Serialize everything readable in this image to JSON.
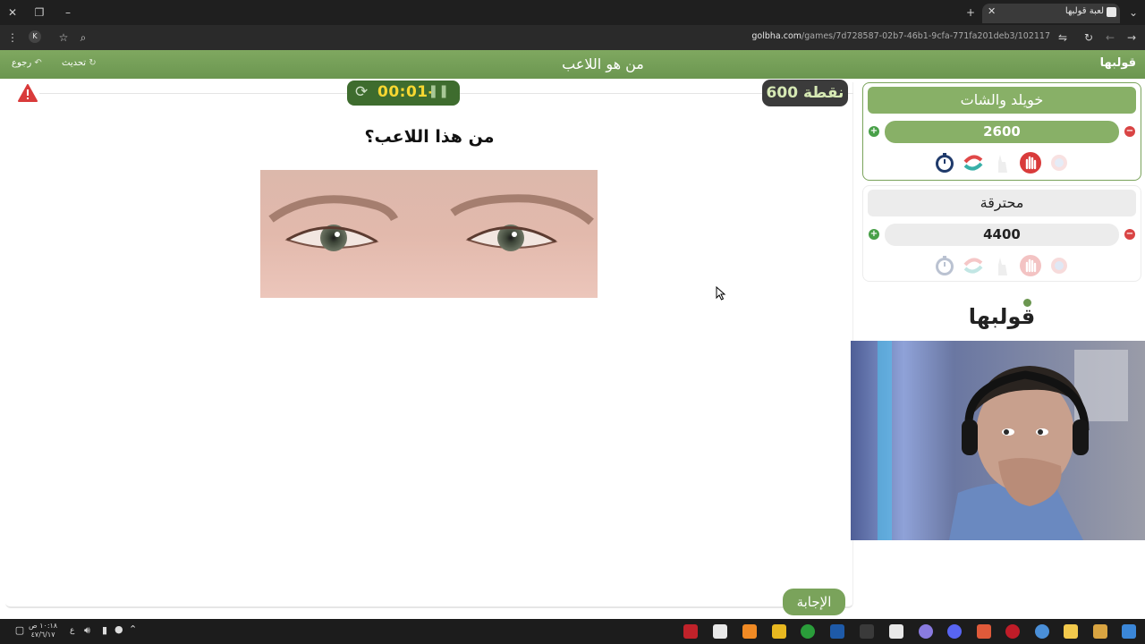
{
  "browser": {
    "tab_title": "لعبة قولبها",
    "url_domain": "golbha.com",
    "url_path": "/games/7d728587-02b7-46b1-9cfa-771fa201deb3/102117",
    "profile_initial": "K"
  },
  "header": {
    "title": "من هو اللاعب",
    "logo": "قولبها",
    "refresh_label": "تحديث",
    "back_label": "رجوع"
  },
  "game": {
    "timer": "00:01-",
    "points": "600 نقطة",
    "question": "من هذا اللاعب؟",
    "answer_button": "الإجابة"
  },
  "teams": [
    {
      "name": "خويلد والشات",
      "score": "2600",
      "active": true
    },
    {
      "name": "محترقة",
      "score": "4400",
      "active": false
    }
  ],
  "brand_logo": "قولبها",
  "taskbar": {
    "time": "١٠:١٨ ص",
    "date": "٤٧/٦/١٧",
    "lang": "ع"
  },
  "colors": {
    "brand_green": "#7aa35b",
    "timer_bg": "#3e6c2e",
    "timer_text": "#f7d731",
    "points_bg": "#3b3b3b"
  }
}
